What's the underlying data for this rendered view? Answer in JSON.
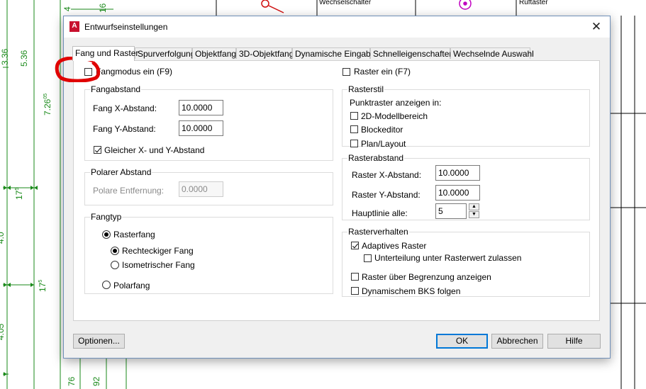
{
  "background": {
    "dims_top": [
      "4",
      "16"
    ],
    "dims_left": [
      "3.36",
      "5.36",
      "7.26",
      "17",
      "17",
      "4.0",
      "4.05",
      "76",
      "92"
    ],
    "dim_7_26_sup": "05",
    "dim_17_sup": "5",
    "labels": [
      "Wechselschalter",
      "Ruftaster"
    ]
  },
  "dialog": {
    "title": "Entwurfseinstellungen",
    "close_glyph": "✕",
    "tabs": [
      "Fang und Raster",
      "Spurverfolgung",
      "Objektfang",
      "3D-Objektfang",
      "Dynamische Eingabe",
      "Schnelleigenschaften",
      "Wechselnde Auswahl"
    ],
    "snap_mode": {
      "label": "Fangmodus ein (F9)",
      "checked": false
    },
    "grid_on": {
      "label": "Raster ein (F7)",
      "checked": false
    },
    "snap_spacing": {
      "title": "Fangabstand",
      "x_label": "Fang X-Abstand:",
      "x_value": "10.0000",
      "y_label": "Fang Y-Abstand:",
      "y_value": "10.0000",
      "equal_label": "Gleicher X- und Y-Abstand",
      "equal_checked": true
    },
    "polar_spacing": {
      "title": "Polarer Abstand",
      "distance_label": "Polare Entfernung:",
      "distance_value": "0.0000"
    },
    "snap_type": {
      "title": "Fangtyp",
      "grid_snap": "Rasterfang",
      "rect_snap": "Rechteckiger Fang",
      "iso_snap": "Isometrischer Fang",
      "polar_snap": "Polarfang",
      "selected": "Rasterfang",
      "sub_selected": "Rechteckiger Fang"
    },
    "grid_style": {
      "title": "Rasterstil",
      "show_label": "Punktraster anzeigen in:",
      "model": "2D-Modellbereich",
      "block": "Blockeditor",
      "layout": "Plan/Layout"
    },
    "grid_spacing": {
      "title": "Rasterabstand",
      "x_label": "Raster X-Abstand:",
      "x_value": "10.0000",
      "y_label": "Raster Y-Abstand:",
      "y_value": "10.0000",
      "major_label": "Hauptlinie alle:",
      "major_value": "5"
    },
    "grid_behavior": {
      "title": "Rasterverhalten",
      "adaptive": "Adaptives Raster",
      "adaptive_checked": true,
      "subdivision": "Unterteilung unter Rasterwert zulassen",
      "subdivision_checked": false,
      "beyond_limits": "Raster über Begrenzung anzeigen",
      "beyond_limits_checked": false,
      "follow_ucs": "Dynamischem BKS folgen",
      "follow_ucs_checked": false
    },
    "buttons": {
      "options": "Optionen...",
      "ok": "OK",
      "cancel": "Abbrechen",
      "help": "Hilfe"
    }
  },
  "icons": {
    "app": "autocad-icon",
    "close": "close-icon",
    "spin_up": "▲",
    "spin_down": "▼",
    "app_letter": "A"
  },
  "colors": {
    "cad_lines": "#1a8a1a",
    "annotation": "#e00000",
    "accent": "#0078d7"
  }
}
